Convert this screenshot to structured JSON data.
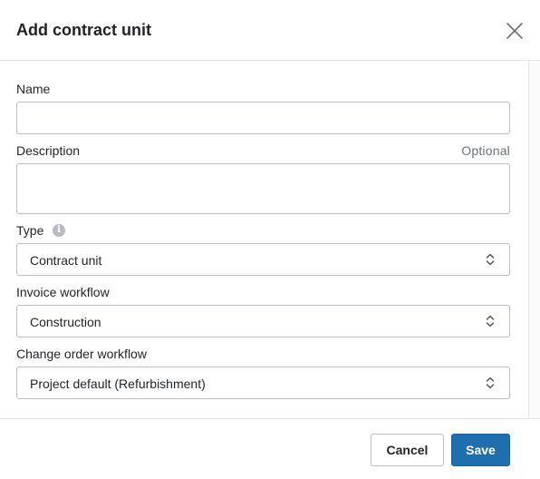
{
  "dialog": {
    "title": "Add contract unit",
    "close_icon": "close-icon"
  },
  "form": {
    "name": {
      "label": "Name",
      "value": "",
      "placeholder": ""
    },
    "description": {
      "label": "Description",
      "optional_label": "Optional",
      "value": "",
      "placeholder": ""
    },
    "type": {
      "label": "Type",
      "info_icon": "info-icon",
      "selected": "Contract unit"
    },
    "invoice_workflow": {
      "label": "Invoice workflow",
      "selected": "Construction"
    },
    "change_order_workflow": {
      "label": "Change order workflow",
      "selected": "Project default (Refurbishment)"
    }
  },
  "footer": {
    "cancel_label": "Cancel",
    "save_label": "Save"
  },
  "colors": {
    "primary": "#1f6ead",
    "border": "#b9bec5",
    "text": "#1f2328",
    "muted": "#6b7178"
  }
}
